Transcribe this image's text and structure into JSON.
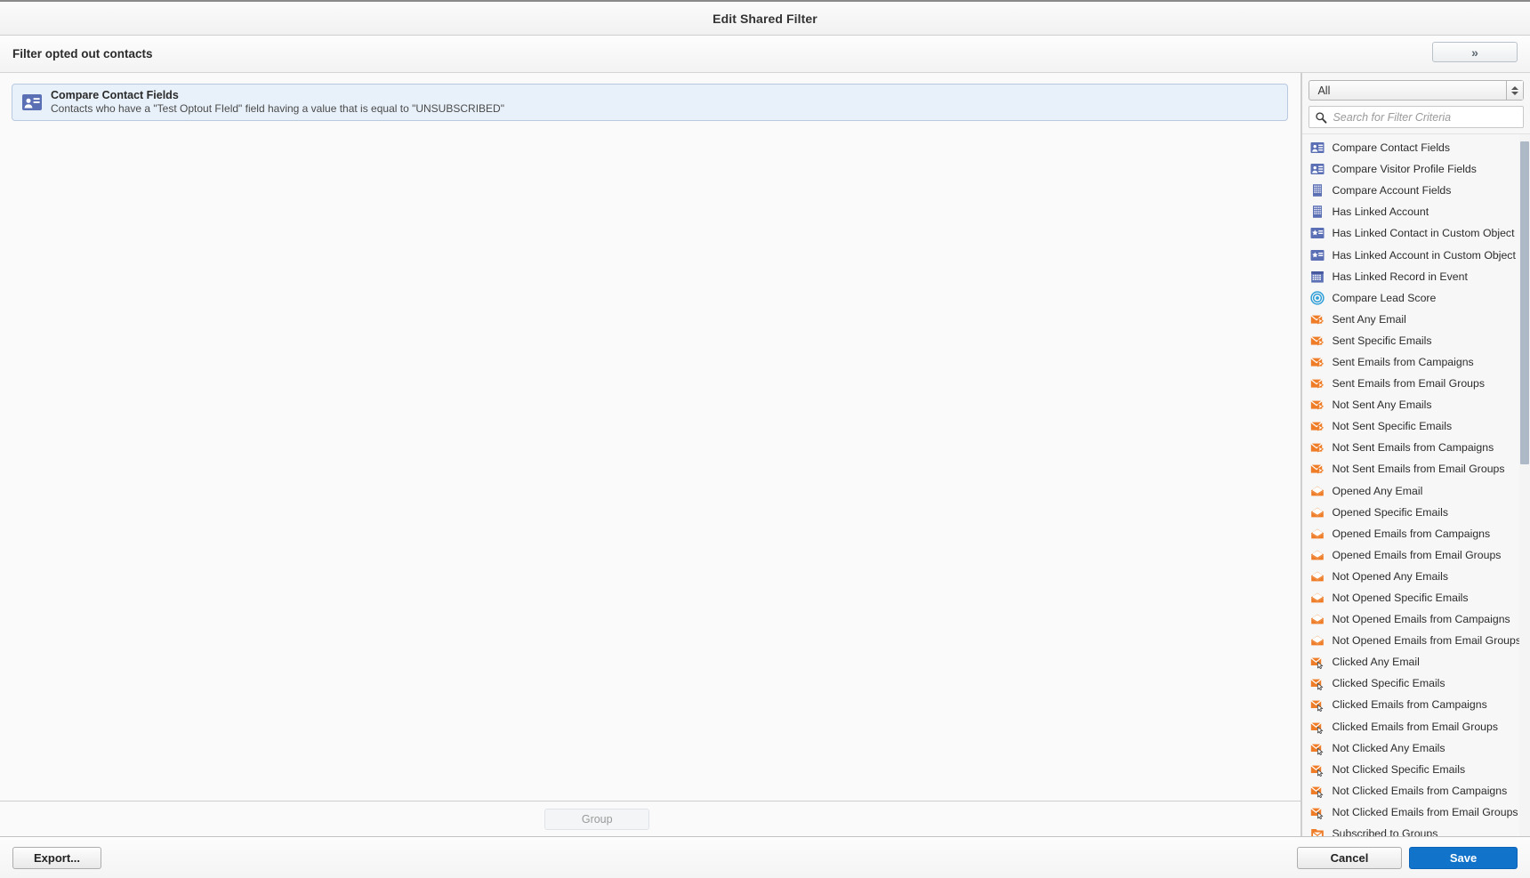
{
  "window": {
    "title": "Edit Shared Filter"
  },
  "filter_header": {
    "name": "Filter opted out contacts",
    "expand_button_label": "»",
    "expand_button_name": "expand-panel-button"
  },
  "canvas": {
    "criterion": {
      "icon": "contact-card-icon",
      "title": "Compare Contact Fields",
      "description": "Contacts who have a \"Test Optout FIeld\" field having a value that is equal to \"UNSUBSCRIBED\""
    },
    "group_button_label": "Group"
  },
  "right_panel": {
    "filter_type_select": {
      "value": "All",
      "options": [
        "All"
      ]
    },
    "search": {
      "value": "",
      "placeholder": "Search for Filter Criteria"
    },
    "scrollbar": {
      "thumb_top_pct": 1,
      "thumb_height_pct": 46
    },
    "criteria": [
      {
        "label": "Compare Contact Fields",
        "icon": "contact-card-icon"
      },
      {
        "label": "Compare Visitor Profile Fields",
        "icon": "contact-card-icon"
      },
      {
        "label": "Compare Account Fields",
        "icon": "building-icon"
      },
      {
        "label": "Has Linked Account",
        "icon": "building-icon"
      },
      {
        "label": "Has Linked Contact in Custom Object",
        "icon": "star-card-icon"
      },
      {
        "label": "Has Linked Account in Custom Object",
        "icon": "star-card-icon"
      },
      {
        "label": "Has Linked Record in Event",
        "icon": "calendar-icon"
      },
      {
        "label": "Compare Lead Score",
        "icon": "target-icon"
      },
      {
        "label": "Sent Any Email",
        "icon": "sent-email-icon"
      },
      {
        "label": "Sent Specific Emails",
        "icon": "sent-email-icon"
      },
      {
        "label": "Sent Emails from Campaigns",
        "icon": "sent-email-icon"
      },
      {
        "label": "Sent Emails from Email Groups",
        "icon": "sent-email-icon"
      },
      {
        "label": "Not Sent Any Emails",
        "icon": "sent-email-icon"
      },
      {
        "label": "Not Sent Specific Emails",
        "icon": "sent-email-icon"
      },
      {
        "label": "Not Sent Emails from Campaigns",
        "icon": "sent-email-icon"
      },
      {
        "label": "Not Sent Emails from Email Groups",
        "icon": "sent-email-icon"
      },
      {
        "label": "Opened Any Email",
        "icon": "opened-email-icon"
      },
      {
        "label": "Opened Specific Emails",
        "icon": "opened-email-icon"
      },
      {
        "label": "Opened Emails from Campaigns",
        "icon": "opened-email-icon"
      },
      {
        "label": "Opened Emails from Email Groups",
        "icon": "opened-email-icon"
      },
      {
        "label": "Not Opened Any Emails",
        "icon": "opened-email-icon"
      },
      {
        "label": "Not Opened Specific Emails",
        "icon": "opened-email-icon"
      },
      {
        "label": "Not Opened Emails from Campaigns",
        "icon": "opened-email-icon"
      },
      {
        "label": "Not Opened Emails from Email Groups",
        "icon": "opened-email-icon"
      },
      {
        "label": "Clicked Any Email",
        "icon": "clicked-email-icon"
      },
      {
        "label": "Clicked Specific Emails",
        "icon": "clicked-email-icon"
      },
      {
        "label": "Clicked Emails from Campaigns",
        "icon": "clicked-email-icon"
      },
      {
        "label": "Clicked Emails from Email Groups",
        "icon": "clicked-email-icon"
      },
      {
        "label": "Not Clicked Any Emails",
        "icon": "clicked-email-icon"
      },
      {
        "label": "Not Clicked Specific Emails",
        "icon": "clicked-email-icon"
      },
      {
        "label": "Not Clicked Emails from Campaigns",
        "icon": "clicked-email-icon"
      },
      {
        "label": "Not Clicked Emails from Email Groups",
        "icon": "clicked-email-icon"
      },
      {
        "label": "Subscribed to Groups",
        "icon": "subscribed-group-icon"
      }
    ]
  },
  "footer": {
    "export_label": "Export...",
    "cancel_label": "Cancel",
    "save_label": "Save"
  },
  "colors": {
    "accent_blue": "#1174ca",
    "card_blue_bg": "#e8f1fa",
    "card_blue_border": "#b9c9df",
    "icon_blue": "#5b6fb5",
    "icon_orange": "#ef7d28",
    "scroll_thumb": "#adb9c7"
  }
}
